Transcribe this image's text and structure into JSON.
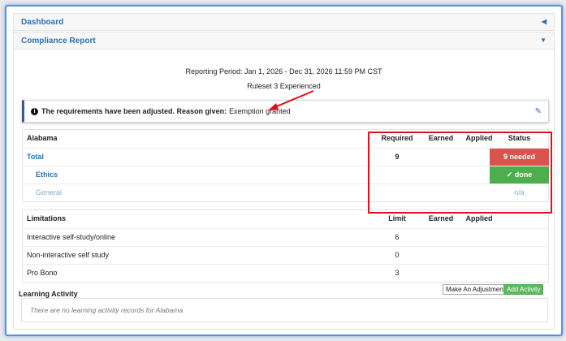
{
  "panels": {
    "dashboard": "Dashboard",
    "compliance": "Compliance Report"
  },
  "report": {
    "period": "Reporting Period: Jan 1, 2026 - Dec 31, 2026 11:59 PM CST",
    "ruleset": "Ruleset 3 Experienced"
  },
  "notice": {
    "bold": "The requirements have been adjusted. Reason given:",
    "reason": "Exemption granted"
  },
  "requirements": {
    "headers": {
      "label": "Alabama",
      "required": "Required",
      "earned": "Earned",
      "applied": "Applied",
      "status": "Status"
    },
    "rows": [
      {
        "label": "Total",
        "required": "9",
        "status": "9 needed"
      },
      {
        "label": "Ethics",
        "required": "",
        "status": "✓ done"
      },
      {
        "label": "General",
        "required": "",
        "status": "n/a"
      }
    ]
  },
  "limitations": {
    "headers": {
      "label": "Limitations",
      "limit": "Limit",
      "earned": "Earned",
      "applied": "Applied"
    },
    "rows": [
      {
        "label": "Interactive self-study/online",
        "limit": "6"
      },
      {
        "label": "Non-interactive self study",
        "limit": "0"
      },
      {
        "label": "Pro Bono",
        "limit": "3"
      }
    ]
  },
  "learning": {
    "title": "Learning Activity",
    "adjust_label": "Make An Adjustment",
    "add_label": "Add Activity",
    "empty": "There are no learning activity records for Alabama"
  },
  "colors": {
    "accent": "#2a72b8",
    "danger": "#d9534f",
    "success": "#4cae4c",
    "annotation": "#e0101a"
  }
}
